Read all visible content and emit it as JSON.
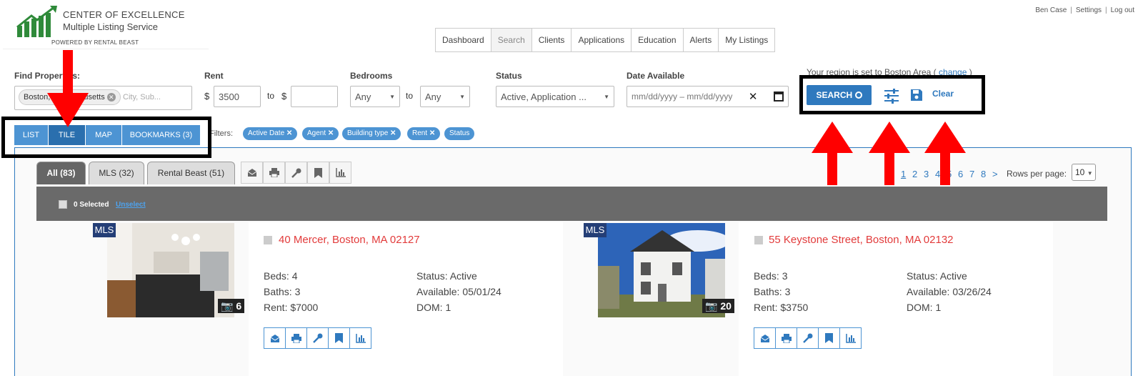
{
  "header": {
    "logo": {
      "title": "CENTER OF EXCELLENCE",
      "subtitle": "Multiple Listing Service",
      "powered": "POWERED BY RENTAL BEAST"
    },
    "top_links": [
      "Ben Case",
      "Settings",
      "Log out"
    ],
    "nav_tabs": [
      "Dashboard",
      "Search",
      "Clients",
      "Applications",
      "Education",
      "Alerts",
      "My Listings"
    ],
    "active_tab": "Search"
  },
  "search": {
    "find_label": "Find Properties:",
    "location_chip": "Boston, Massachusetts",
    "location_placeholder": "City, Sub...",
    "rent_label": "Rent",
    "currency": "$",
    "rent_min": "3500",
    "rent_max": "",
    "to": "to",
    "bedrooms_label": "Bedrooms",
    "bed_min": "Any",
    "bed_max": "Any",
    "status_label": "Status",
    "status_value": "Active, Application ...",
    "date_label": "Date Available",
    "date_value": "mm/dd/yyyy – mm/dd/yyyy",
    "region_text": "Your region is set to Boston Area (",
    "region_link": "change",
    "region_close": ")",
    "search_btn": "SEARCH",
    "clear_btn": "Clear"
  },
  "view_tabs": [
    {
      "label": "LIST",
      "active": false
    },
    {
      "label": "TILE",
      "active": true
    },
    {
      "label": "MAP",
      "active": false
    },
    {
      "label": "BOOKMARKS (3)",
      "active": false
    }
  ],
  "filters_label": "Filters:",
  "filter_chips": [
    "Active Date",
    "Agent",
    "Building type",
    "Rent",
    "Status"
  ],
  "result_tabs": [
    {
      "label": "All (83)",
      "active": true
    },
    {
      "label": "MLS (32)",
      "active": false
    },
    {
      "label": "Rental Beast (51)",
      "active": false
    }
  ],
  "pagination": {
    "pages": [
      "1",
      "2",
      "3",
      "4",
      "5",
      "6",
      "7",
      "8",
      ">"
    ],
    "current": "1",
    "rows_label": "Rows per page:",
    "rows_value": "10"
  },
  "selection": {
    "count_text": "0 Selected",
    "unselect": "Unselect"
  },
  "listings": [
    {
      "badge": "MLS",
      "photos": "6",
      "address": "40 Mercer, Boston, MA 02127",
      "beds": "Beds: 4",
      "baths": "Baths: 3",
      "rent": "Rent: $7000",
      "status": "Status: Active",
      "available": "Available: 05/01/24",
      "dom": "DOM: 1"
    },
    {
      "badge": "MLS",
      "photos": "20",
      "address": "55 Keystone Street, Boston, MA 02132",
      "beds": "Beds: 3",
      "baths": "Baths: 3",
      "rent": "Rent: $3750",
      "status": "Status: Active",
      "available": "Available: 03/26/24",
      "dom": "DOM: 1"
    }
  ],
  "icons": {
    "email": "email-open-icon",
    "print": "print-icon",
    "key": "key-icon",
    "bookmark": "bookmark-icon",
    "chart": "chart-icon"
  },
  "colors": {
    "primary": "#2f79be",
    "tab_light": "#4d94d3",
    "address": "#e23b3b",
    "annotation": "#ff0000"
  }
}
